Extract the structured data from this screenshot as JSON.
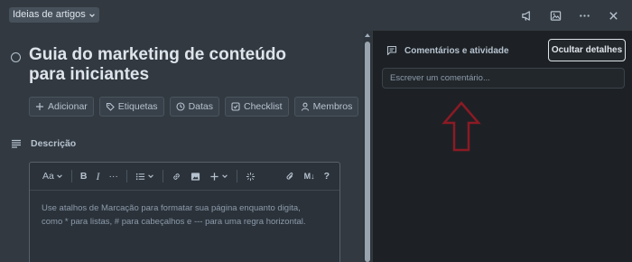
{
  "header": {
    "list_name": "Ideias de artigos",
    "icons": [
      "megaphone-icon",
      "image-icon",
      "more-icon",
      "close-icon"
    ]
  },
  "card": {
    "title": "Guia do marketing de conteúdo para iniciantes",
    "actions": [
      {
        "label": "Adicionar",
        "icon": "plus-icon"
      },
      {
        "label": "Etiquetas",
        "icon": "tag-icon"
      },
      {
        "label": "Datas",
        "icon": "clock-icon"
      },
      {
        "label": "Checklist",
        "icon": "checkbox-icon"
      },
      {
        "label": "Membros",
        "icon": "user-icon"
      }
    ]
  },
  "description": {
    "heading": "Descrição",
    "toolbar": {
      "text_style": "Aa",
      "bold": "B",
      "italic": "I",
      "more": "···",
      "markdown": "M↓",
      "help": "?"
    },
    "placeholder": "Use atalhos de Marcação para formatar sua página enquanto digita, como * para listas, # para cabeçalhos e --- para uma regra horizontal."
  },
  "sidebar": {
    "heading": "Comentários e atividade",
    "hide_details": "Ocultar detalhes",
    "comment_placeholder": "Escrever um comentário..."
  },
  "colors": {
    "main_bg": "#323940",
    "side_bg": "#1d2125",
    "text": "#b6c2cf",
    "annotation_arrow": "#8b1a24"
  }
}
